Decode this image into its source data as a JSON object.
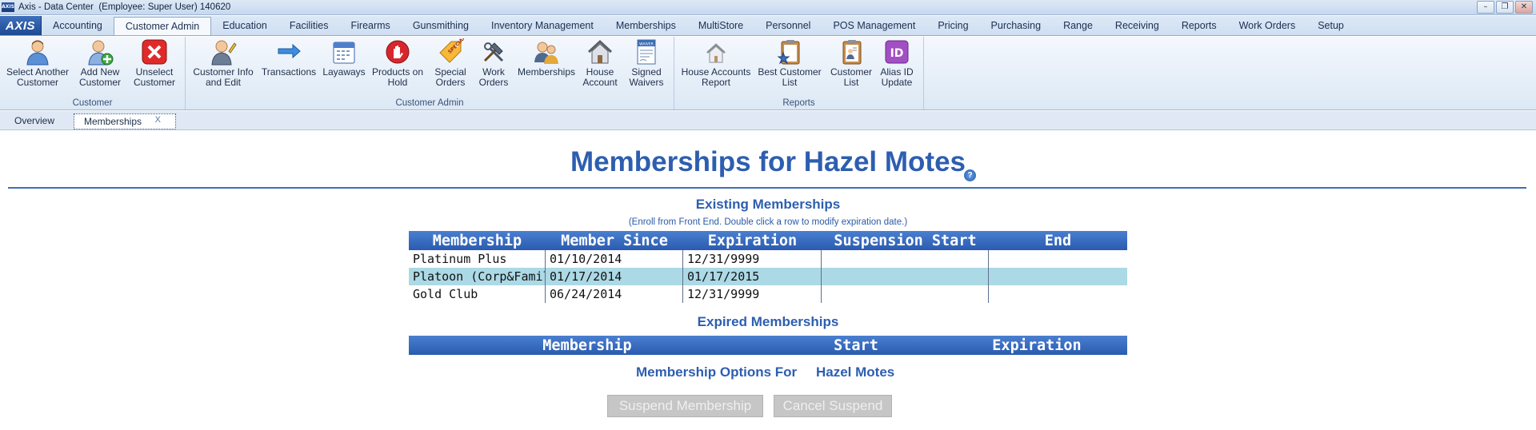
{
  "window": {
    "title": "Axis - Data Center  (Employee: Super User) 140620",
    "app_logo": "AXIS",
    "controls": {
      "minimize": "–",
      "restore": "❐",
      "close": "✕"
    }
  },
  "menu": {
    "app_button": "AXIS",
    "tabs": [
      "Accounting",
      "Customer Admin",
      "Education",
      "Facilities",
      "Firearms",
      "Gunsmithing",
      "Inventory Management",
      "Memberships",
      "MultiStore",
      "Personnel",
      "POS Management",
      "Pricing",
      "Purchasing",
      "Range",
      "Receiving",
      "Reports",
      "Work Orders",
      "Setup"
    ],
    "active": "Customer Admin"
  },
  "ribbon": {
    "customer": {
      "label": "Customer",
      "select_another": [
        "Select Another",
        "Customer"
      ],
      "add_new": [
        "Add New",
        "Customer"
      ],
      "unselect": [
        "Unselect",
        "Customer"
      ]
    },
    "customer_admin": {
      "label": "Customer Admin",
      "info_edit": [
        "Customer Info",
        "and Edit"
      ],
      "transactions": [
        "Transactions",
        ""
      ],
      "layaways": [
        "Layaways",
        ""
      ],
      "products_on_hold": [
        "Products on",
        "Hold"
      ],
      "special_orders": [
        "Special",
        "Orders"
      ],
      "work_orders": [
        "Work",
        "Orders"
      ],
      "memberships": [
        "Memberships",
        ""
      ],
      "house_account": [
        "House",
        "Account"
      ],
      "signed_waivers": [
        "Signed",
        "Waivers"
      ]
    },
    "reports": {
      "label": "Reports",
      "house_accounts_report": [
        "House Accounts",
        "Report"
      ],
      "best_customer_list": [
        "Best Customer",
        "List"
      ],
      "customer_list": [
        "Customer",
        "List"
      ],
      "alias_id_update": [
        "Alias ID",
        "Update"
      ]
    }
  },
  "doc_tabs": {
    "overview": "Overview",
    "memberships": "Memberships",
    "close": "X"
  },
  "page": {
    "title": "Memberships for Hazel Motes",
    "help": "?",
    "existing": {
      "heading": "Existing Memberships",
      "hint": "(Enroll from Front End. Double click a row to modify expiration date.)",
      "columns": [
        "Membership",
        "Member Since",
        "Expiration",
        "Suspension Start",
        "End"
      ],
      "rows": [
        [
          "Platinum Plus",
          "01/10/2014",
          "12/31/9999",
          "",
          ""
        ],
        [
          "Platoon (Corp&Family)",
          "01/17/2014",
          "01/17/2015",
          "",
          ""
        ],
        [
          "Gold Club",
          "06/24/2014",
          "12/31/9999",
          "",
          ""
        ]
      ]
    },
    "expired": {
      "heading": "Expired Memberships",
      "columns": [
        "Membership",
        "Start",
        "Expiration"
      ]
    },
    "options": {
      "label": "Membership Options For",
      "customer": "Hazel Motes"
    },
    "buttons": {
      "suspend": "Suspend Membership",
      "cancel_suspend": "Cancel Suspend"
    }
  }
}
